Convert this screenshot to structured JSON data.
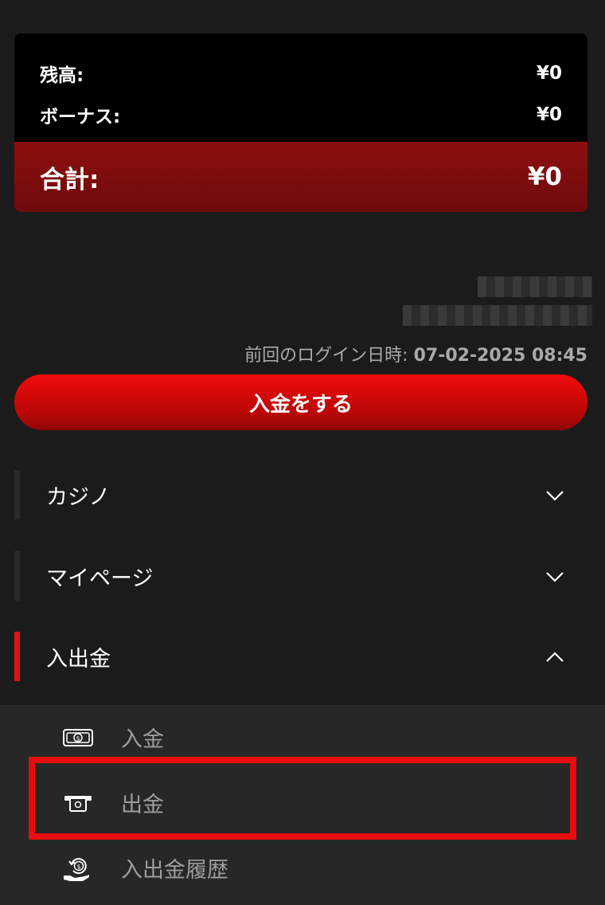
{
  "balance": {
    "cash_label": "残高:",
    "cash_value": "¥0",
    "bonus_label": "ボーナス:",
    "bonus_value": "¥0",
    "total_label": "合計:",
    "total_value": "¥0"
  },
  "last_login": {
    "label": "前回のログイン日時: ",
    "timestamp": "07-02-2025 08:45"
  },
  "deposit_button_label": "入金をする",
  "menu": {
    "casino": "カジノ",
    "mypage": "マイページ",
    "banking": "入出金"
  },
  "submenu": {
    "deposit": "入金",
    "withdraw": "出金",
    "history": "入出金履歴"
  },
  "colors": {
    "accent": "#e21212",
    "highlight": "#e50d0d",
    "background": "#1b1b1b"
  },
  "icons": {
    "deposit": "cash-bill-icon",
    "withdraw": "atm-withdraw-icon",
    "history": "money-refresh-hand-icon"
  }
}
